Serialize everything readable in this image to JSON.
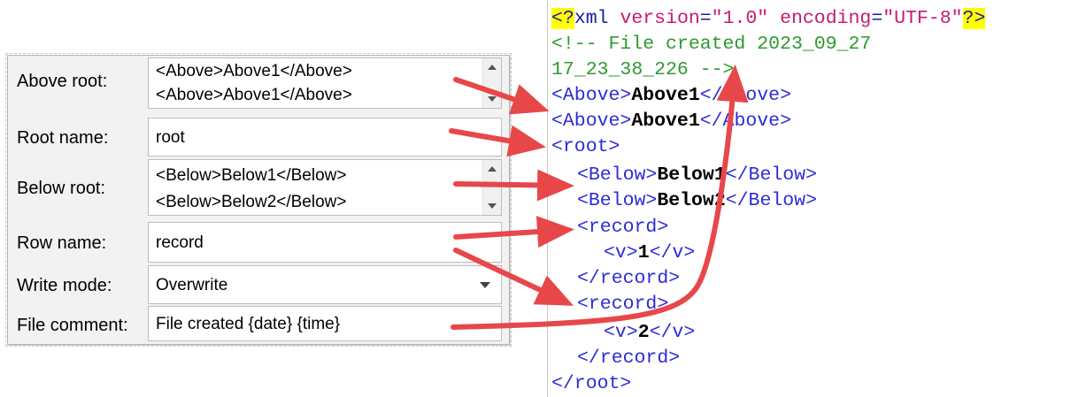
{
  "form": {
    "above_root": {
      "label": "Above root:",
      "lines": [
        "<Above>Above1</Above>",
        "<Above>Above1</Above>"
      ]
    },
    "root_name": {
      "label": "Root name:",
      "value": "root"
    },
    "below_root": {
      "label": "Below root:",
      "lines": [
        "<Below>Below1</Below>",
        "<Below>Below2</Below>"
      ]
    },
    "row_name": {
      "label": "Row name:",
      "value": "record"
    },
    "write_mode": {
      "label": "Write mode:",
      "value": "Overwrite"
    },
    "file_comment": {
      "label": "File comment:",
      "value": "File created {date} {time}"
    }
  },
  "xml": {
    "decl": {
      "open": "<?",
      "name": "xml",
      "attr1": "version",
      "val1": "\"1.0\"",
      "attr2": "encoding",
      "val2": "\"UTF-8\"",
      "close": "?>"
    },
    "comment_line1": "<!-- File created 2023_09_27",
    "comment_line2": "17_23_38_226 -->",
    "above1": {
      "open": "<Above>",
      "text": "Above1",
      "close": "</Above>"
    },
    "above2": {
      "open": "<Above>",
      "text": "Above1",
      "close": "</Above>"
    },
    "root_open": "<root>",
    "below1": {
      "open": "<Below>",
      "text": "Below1",
      "close": "</Below>"
    },
    "below2": {
      "open": "<Below>",
      "text": "Below2",
      "close": "</Below>"
    },
    "record1_open": "<record>",
    "v1": {
      "open": "<v>",
      "text": "1",
      "close": "</v>"
    },
    "record1_close": "</record>",
    "record2_open": "<record>",
    "v2": {
      "open": "<v>",
      "text": "2",
      "close": "</v>"
    },
    "record2_close": "</record>",
    "root_close": "</root>"
  },
  "colors": {
    "arrow": "#e8474a",
    "comment": "#2f9a2f",
    "tag": "#2c2cd8",
    "attr": "#c71a73",
    "pi_highlight": "#ffff00"
  }
}
